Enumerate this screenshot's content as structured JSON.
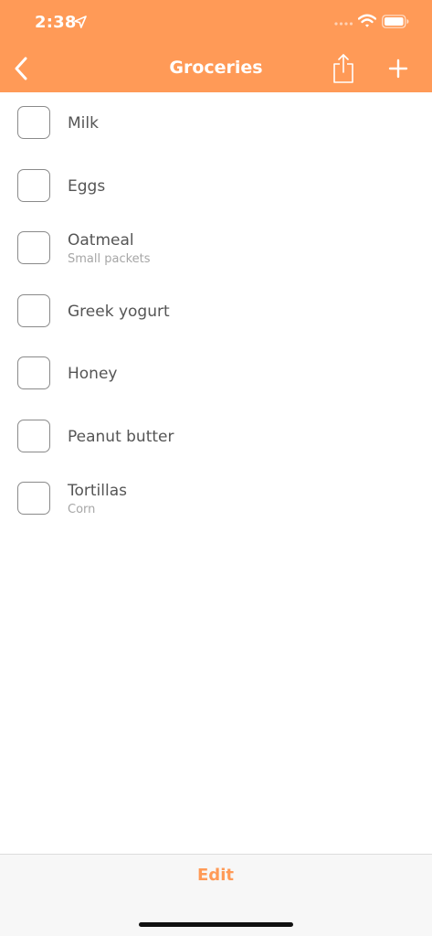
{
  "status_bar": {
    "time": "2:38"
  },
  "nav": {
    "title": "Groceries"
  },
  "items": [
    {
      "name": "Milk",
      "note": ""
    },
    {
      "name": "Eggs",
      "note": ""
    },
    {
      "name": "Oatmeal",
      "note": "Small packets"
    },
    {
      "name": "Greek yogurt",
      "note": ""
    },
    {
      "name": "Honey",
      "note": ""
    },
    {
      "name": "Peanut butter",
      "note": ""
    },
    {
      "name": "Tortillas",
      "note": "Corn"
    }
  ],
  "toolbar": {
    "edit_label": "Edit"
  },
  "colors": {
    "accent": "#FF9A57",
    "text": "#555555",
    "subtext": "#a6a6a6"
  },
  "icons": {
    "back": "chevron-left-icon",
    "share": "share-icon",
    "add": "plus-icon"
  }
}
